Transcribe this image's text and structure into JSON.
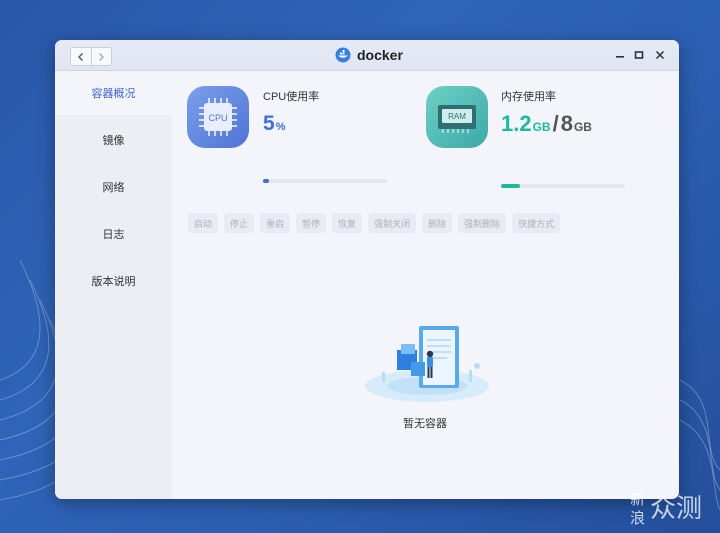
{
  "window": {
    "title": "docker"
  },
  "nav": {
    "back_icon": "chevron-left-icon",
    "forward_icon": "chevron-right-icon"
  },
  "sidebar": {
    "items": [
      {
        "label": "容器概况",
        "active": true
      },
      {
        "label": "镜像"
      },
      {
        "label": "网络"
      },
      {
        "label": "日志"
      },
      {
        "label": "版本说明"
      }
    ]
  },
  "stats": {
    "cpu": {
      "label": "CPU使用率",
      "icon_text": "CPU",
      "value": "5",
      "unit": "%",
      "percent": 5,
      "color": "#3f6fd8"
    },
    "ram": {
      "label": "内存使用率",
      "icon_text": "RAM",
      "used": "1.2",
      "used_unit": "GB",
      "sep": "/",
      "total": "8",
      "total_unit": "GB",
      "percent": 15,
      "color": "#1db9a0"
    }
  },
  "actions": [
    "启动",
    "停止",
    "重启",
    "暂停",
    "恢复",
    "强制关闭",
    "删除",
    "强制删除",
    "快捷方式"
  ],
  "empty": {
    "text": "暂无容器"
  },
  "watermark": {
    "text": "新浪众测"
  },
  "colors": {
    "accent": "#3f5fd2",
    "teal": "#1db9a0"
  }
}
